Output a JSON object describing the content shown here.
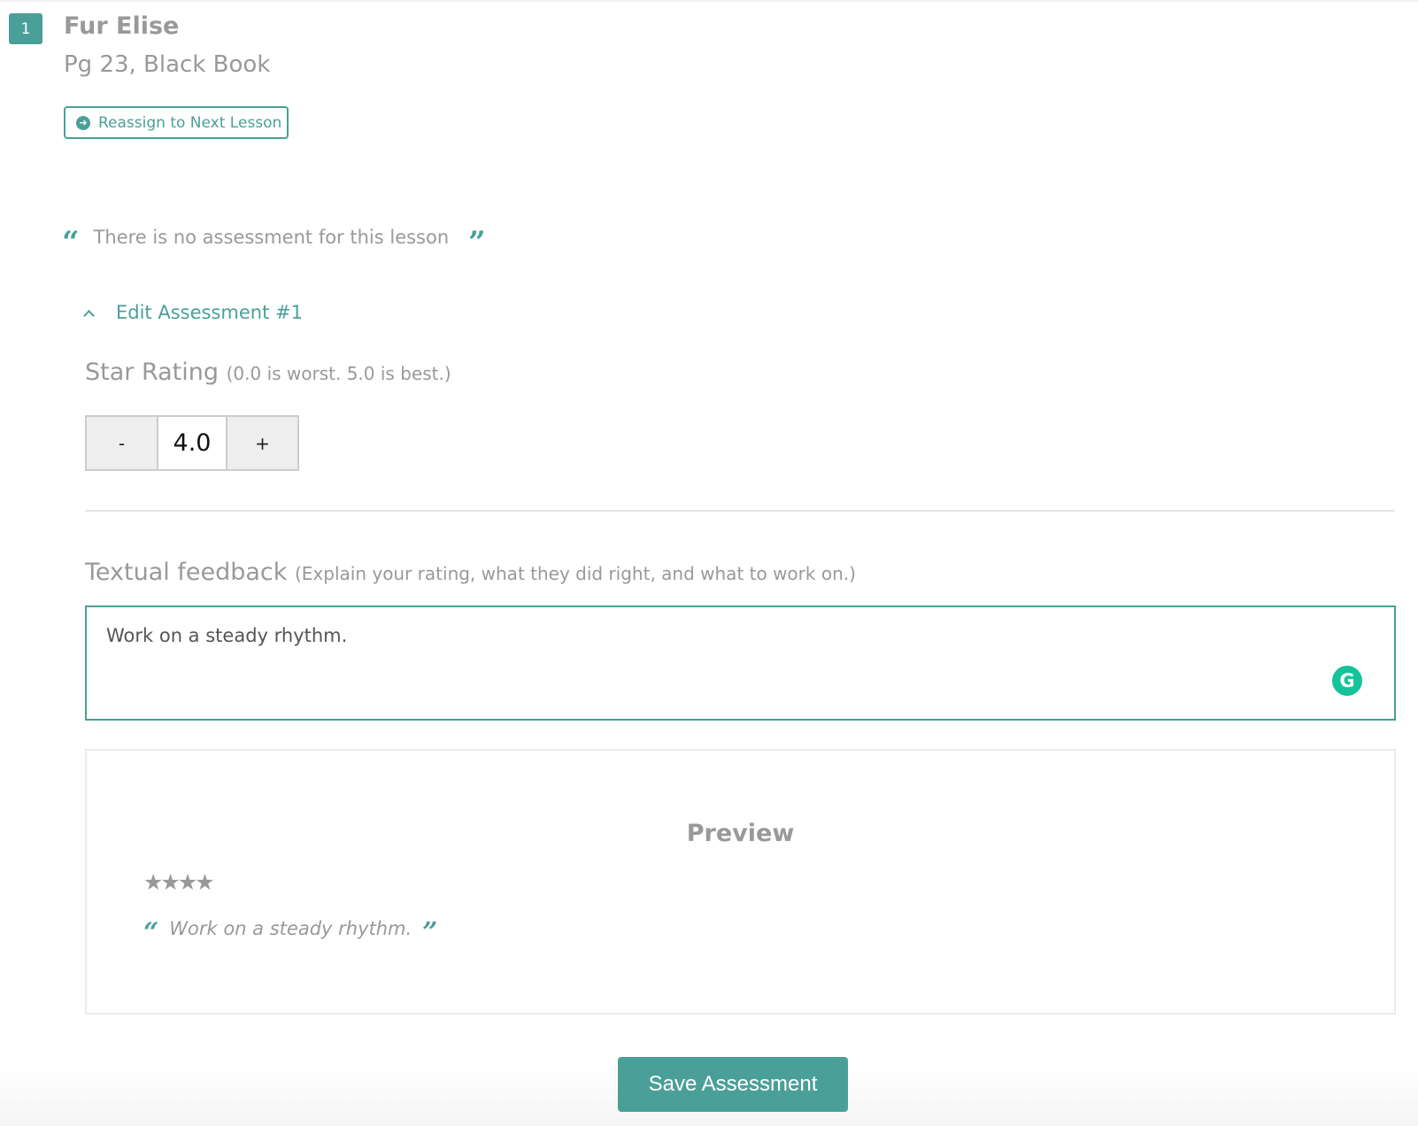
{
  "lesson": {
    "number": "1",
    "title": "Fur Elise",
    "subtitle": "Pg 23, Black Book",
    "reassign_label": "Reassign to Next Lesson",
    "reassign_icon": "arrow-circle-right-icon"
  },
  "assessment_status": {
    "message": "There is no assessment for this lesson",
    "open_quote": "“",
    "close_quote": "”"
  },
  "edit_section": {
    "toggle_label": "Edit Assessment #1",
    "toggle_icon": "chevron-up-icon",
    "expanded": true
  },
  "star_rating": {
    "label": "Star Rating",
    "hint": "(0.0 is worst. 5.0 is best.)",
    "decrement_label": "-",
    "increment_label": "+",
    "value": "4.0",
    "min": 0.0,
    "max": 5.0
  },
  "feedback": {
    "label": "Textual feedback",
    "hint": "(Explain your rating, what they did right, and what to work on.)",
    "value": "Work on a steady rhythm.",
    "grammarly_icon": "G"
  },
  "preview": {
    "title": "Preview",
    "stars_filled": 4,
    "stars_text": "★★★★",
    "quote_text": "Work on a steady rhythm.",
    "open_quote": "“",
    "close_quote": "”"
  },
  "actions": {
    "save_label": "Save Assessment"
  },
  "colors": {
    "accent": "#4aa098",
    "text_muted": "#999999",
    "grammarly": "#15c39a"
  }
}
